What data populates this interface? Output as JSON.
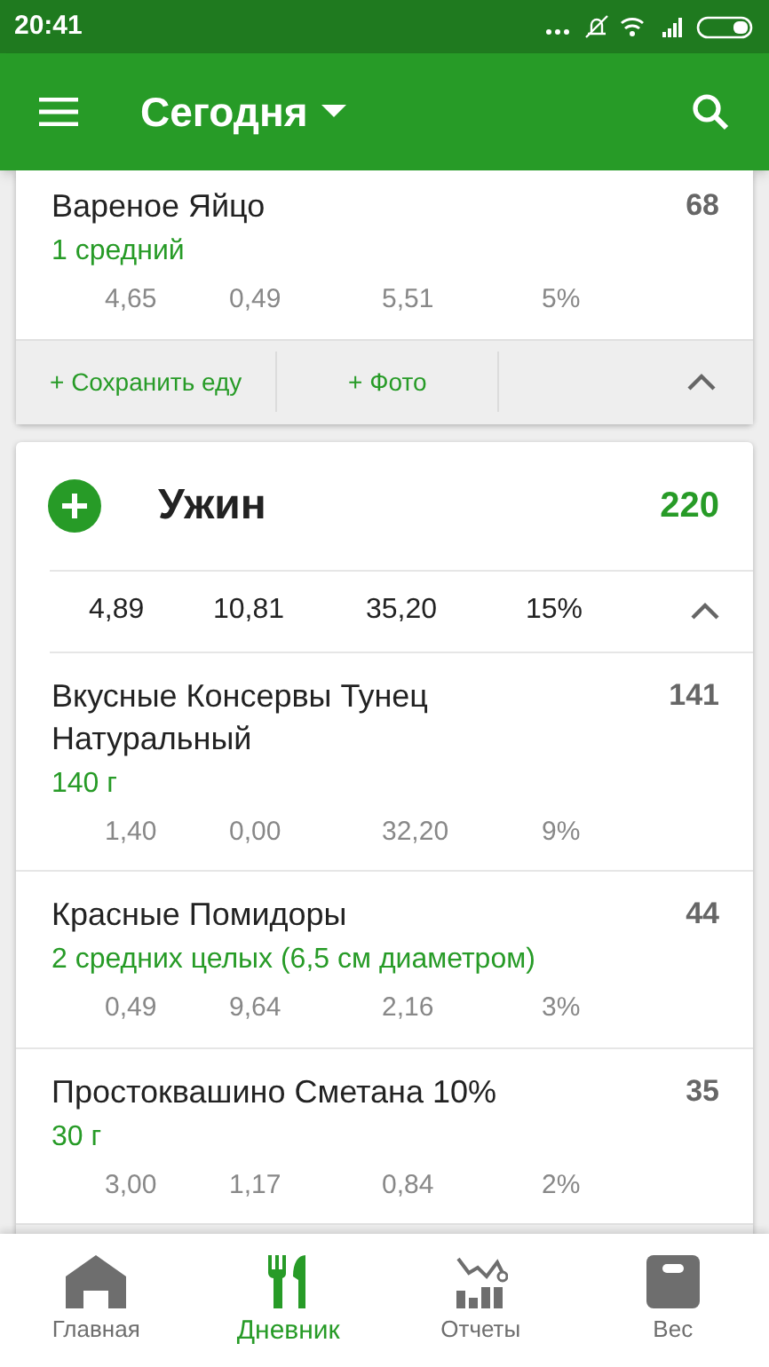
{
  "status_bar": {
    "time": "20:41"
  },
  "app_bar": {
    "title": "Сегодня"
  },
  "meals": [
    {
      "foods": [
        {
          "name": "Вареное Яйцо",
          "serving": "1  средний",
          "kcal": "68",
          "macros": [
            "4,65",
            "0,49",
            "5,51",
            "5%"
          ]
        }
      ],
      "footer": {
        "save": "+ Сохранить еду",
        "photo": "+ Фото"
      }
    },
    {
      "title": "Ужин",
      "kcal": "220",
      "totals": [
        "4,89",
        "10,81",
        "35,20",
        "15%"
      ],
      "foods": [
        {
          "name": "Вкусные Консервы Тунец Натуральный",
          "serving": "140  г",
          "kcal": "141",
          "macros": [
            "1,40",
            "0,00",
            "32,20",
            "9%"
          ]
        },
        {
          "name": "Красные Помидоры",
          "serving": "2  средних целых (6,5 см диаметром)",
          "kcal": "44",
          "macros": [
            "0,49",
            "9,64",
            "2,16",
            "3%"
          ]
        },
        {
          "name": "Простоквашино Сметана 10%",
          "serving": "30  г",
          "kcal": "35",
          "macros": [
            "3,00",
            "1,17",
            "0,84",
            "2%"
          ]
        }
      ]
    }
  ],
  "bottom_nav": [
    {
      "label": "Главная",
      "selected": false
    },
    {
      "label": "Дневник",
      "selected": true
    },
    {
      "label": "Отчеты",
      "selected": false
    },
    {
      "label": "Вес",
      "selected": false
    }
  ]
}
